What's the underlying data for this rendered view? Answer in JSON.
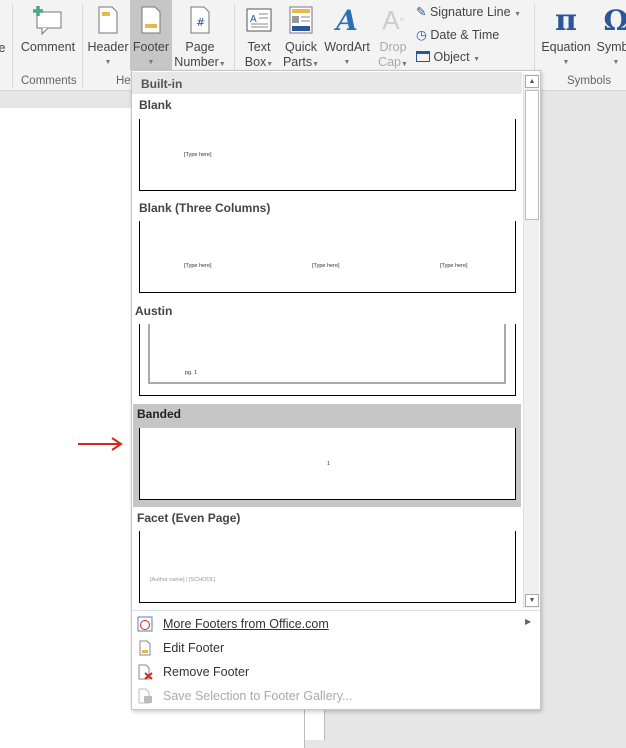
{
  "ribbon": {
    "partial_left": "e",
    "buttons": {
      "comment": "Comment",
      "header": "Header",
      "footer": "Footer",
      "page_number_1": "Page",
      "page_number_2": "Number",
      "text_box_1": "Text",
      "text_box_2": "Box",
      "quick_parts_1": "Quick",
      "quick_parts_2": "Parts",
      "wordart": "WordArt",
      "drop_cap_1": "Drop",
      "drop_cap_2": "Cap",
      "signature_line": "Signature Line",
      "date_time": "Date & Time",
      "object": "Object",
      "equation": "Equation",
      "symbol": "Symbo"
    },
    "groups": {
      "comments": "Comments",
      "header_footer": "He",
      "symbols": "Symbols"
    }
  },
  "dropdown": {
    "section": "Built-in",
    "gallery": [
      {
        "label": "Blank",
        "placeholders": [
          "[Type here]"
        ]
      },
      {
        "label": "Blank (Three Columns)",
        "placeholders": [
          "[Type here]",
          "[Type here]",
          "[Type here]"
        ]
      },
      {
        "label": "Austin",
        "placeholders": [
          "pg. 1"
        ]
      },
      {
        "label": "Banded",
        "placeholders": [
          "1"
        ],
        "selected": true
      },
      {
        "label": "Facet (Even Page)",
        "placeholders": [
          "[Author name]  |  [SCHOOL]"
        ]
      }
    ],
    "menu": [
      {
        "label": "More Footers from Office.com",
        "icon": "office-com-icon",
        "enabled": true,
        "submenu": true
      },
      {
        "label": "Edit Footer",
        "icon": "edit-footer-icon",
        "enabled": true
      },
      {
        "label": "Remove Footer",
        "icon": "remove-footer-icon",
        "enabled": true
      },
      {
        "label": "Save Selection to Footer Gallery...",
        "icon": "save-gallery-icon",
        "enabled": false
      }
    ]
  },
  "colors": {
    "accent": "#2b579a",
    "selected": "#c6c6c6",
    "arrow": "#d9261c"
  }
}
